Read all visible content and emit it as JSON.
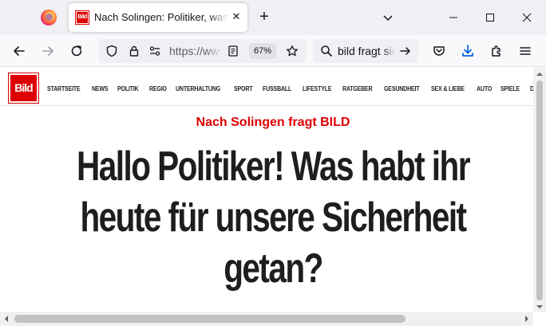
{
  "browser": {
    "tab": {
      "favicon_text": "Bild",
      "title": "Nach Solingen: Politiker, was habt ihr heute für unsere Sicherheit getan?",
      "close_symbol": "✕"
    },
    "new_tab_symbol": "+",
    "url": {
      "text": "https://www.bild.de",
      "zoom": "67%"
    },
    "search": {
      "text": "bild fragt sicherheit"
    },
    "icons": {
      "back": "arrow-left-icon",
      "forward": "arrow-right-icon",
      "reload": "reload-icon",
      "shield": "tracking-shield-icon",
      "lock": "lock-icon",
      "permissions": "permissions-icon",
      "reader": "reader-view-icon",
      "bookmark": "star-icon",
      "search": "search-icon",
      "go": "go-arrow-icon",
      "pocket": "pocket-icon",
      "downloads": "download-icon",
      "extensions": "extensions-icon",
      "menu": "hamburger-menu-icon"
    },
    "colors": {
      "accent_download": "#0061e0"
    }
  },
  "site": {
    "logo_text": "Bild",
    "brand_color": "#dd0000",
    "nav": [
      "STARTSEITE",
      "NEWS",
      "POLITIK",
      "REGIO",
      "UNTERHALTUNG",
      "SPORT",
      "FUSSBALL",
      "LIFESTYLE",
      "RATGEBER",
      "GESUNDHEIT",
      "SEX & LIEBE",
      "AUTO",
      "SPIELE",
      "DEALS"
    ]
  },
  "article": {
    "kicker": "Nach Solingen fragt BILD",
    "headline_lines": [
      "Hallo Politiker! Was habt ihr",
      "heute für unsere Sicherheit",
      "getan?"
    ]
  }
}
